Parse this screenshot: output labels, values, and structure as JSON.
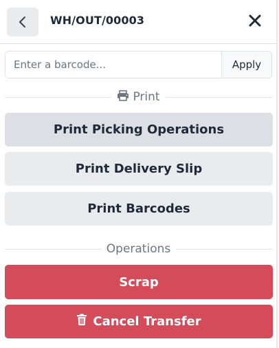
{
  "header": {
    "title": "WH/OUT/00003"
  },
  "barcode": {
    "placeholder": "Enter a barcode...",
    "apply_label": "Apply"
  },
  "print_section": {
    "label": "Print",
    "buttons": [
      {
        "label": "Print Picking Operations"
      },
      {
        "label": "Print Delivery Slip"
      },
      {
        "label": "Print Barcodes"
      }
    ]
  },
  "operations_section": {
    "label": "Operations",
    "scrap_label": "Scrap",
    "cancel_label": "Cancel Transfer"
  },
  "colors": {
    "danger": "#d44c59",
    "secondary": "#e9ecef"
  },
  "icons": {
    "back": "chevron-left-icon",
    "close": "close-icon",
    "print": "printer-icon",
    "cancel": "trash-icon"
  }
}
